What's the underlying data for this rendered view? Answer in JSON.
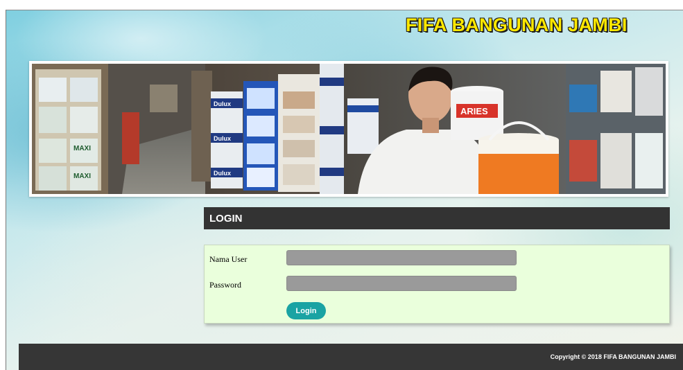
{
  "header": {
    "site_title": "FIFA BANGUNAN JAMBI"
  },
  "banner": {
    "image": "banner-photo",
    "visible_text": [
      "Dulux",
      "Dulux",
      "Dulux",
      "MAXI",
      "MAXI",
      "ARIES"
    ]
  },
  "login": {
    "heading": "LOGIN",
    "username_label": "Nama User",
    "username_value": "",
    "password_label": "Password",
    "password_value": "",
    "button_label": "Login"
  },
  "footer": {
    "copyright": "Copyright © 2018 FIFA BANGUNAN JAMBI"
  },
  "colors": {
    "title": "#ffe800",
    "header_bar": "#333333",
    "form_bg": "#eaffdc",
    "input_bg": "#9a9a9a",
    "button": "#1aa3a3",
    "footer_bg": "#363636"
  }
}
